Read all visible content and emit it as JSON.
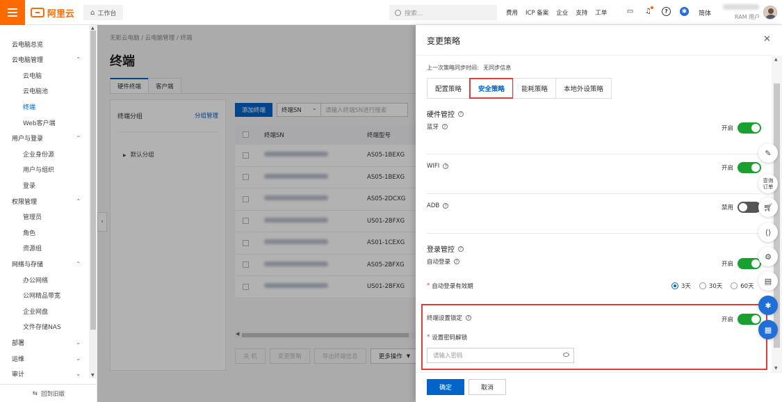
{
  "topbar": {
    "brand": "阿里云",
    "workbench": "工作台",
    "search_placeholder": "搜索...",
    "links": [
      "费用",
      "ICP 备案",
      "企业",
      "支持",
      "工单"
    ],
    "lang": "简体",
    "role": "RAM 用户",
    "icons": [
      "terminal-icon",
      "bell-icon",
      "help-icon",
      "app-icon"
    ]
  },
  "sidebar": {
    "items": [
      {
        "label": "云电脑总览",
        "type": "grp"
      },
      {
        "label": "云电脑管理",
        "type": "grp",
        "chev": "⌃"
      },
      {
        "label": "云电脑",
        "type": "sub"
      },
      {
        "label": "云电脑池",
        "type": "sub"
      },
      {
        "label": "终端",
        "type": "sub",
        "active": true
      },
      {
        "label": "Web客户端",
        "type": "sub"
      },
      {
        "label": "用户与登录",
        "type": "grp",
        "chev": "⌃"
      },
      {
        "label": "企业身份源",
        "type": "sub"
      },
      {
        "label": "用户与组织",
        "type": "sub"
      },
      {
        "label": "登录",
        "type": "sub"
      },
      {
        "label": "权限管理",
        "type": "grp",
        "chev": "⌃"
      },
      {
        "label": "管理员",
        "type": "sub"
      },
      {
        "label": "角色",
        "type": "sub"
      },
      {
        "label": "资源组",
        "type": "sub"
      },
      {
        "label": "网络与存储",
        "type": "grp",
        "chev": "⌃"
      },
      {
        "label": "办公网络",
        "type": "sub"
      },
      {
        "label": "公网精品带宽",
        "type": "sub"
      },
      {
        "label": "企业网盘",
        "type": "sub"
      },
      {
        "label": "文件存储NAS",
        "type": "sub"
      },
      {
        "label": "部署",
        "type": "grp",
        "chev": "⌄"
      },
      {
        "label": "运维",
        "type": "grp",
        "chev": "⌄"
      },
      {
        "label": "审计",
        "type": "grp",
        "chev": "⌄"
      }
    ],
    "footer": "回到旧版"
  },
  "main": {
    "breadcrumb": "无影云电脑 / 云电脑管理 / 终端",
    "title": "终端",
    "tabs": [
      "硬件终端",
      "客户端"
    ],
    "group_panel": {
      "title": "终端分组",
      "manage_link": "分组管理",
      "tree_item": "默认分组"
    },
    "add_button": "添加终端",
    "filter_select": "终端SN",
    "filter_placeholder": "请输入终端SN进行搜索",
    "columns": [
      "终端SN",
      "终端型号"
    ],
    "rows": [
      "AS05-1BEXG",
      "AS05-1BEXG",
      "AS05-2DCXG",
      "US01-2BFXG",
      "AS01-1CEXG",
      "AS05-2BFXG",
      "US01-2BFXG"
    ],
    "bottom_buttons": [
      "关 机",
      "变更策略",
      "导出终端信息",
      "更多操作"
    ]
  },
  "drawer": {
    "title": "变更策略",
    "sync_label": "上一次策略同步时间:",
    "sync_value": "无同步信息",
    "tabs": [
      "配置策略",
      "安全策略",
      "能耗策略",
      "本地外设策略"
    ],
    "hardware_section": "硬件管控",
    "bluetooth": "蓝牙",
    "wifi": "WIFI",
    "adb": "ADB",
    "on_text": "开启",
    "off_text": "禁用",
    "login_section": "登录管控",
    "auto_login": "自动登录",
    "auto_login_validity": "自动登录有效期",
    "validity_options": [
      "3天",
      "30天",
      "60天"
    ],
    "device_lock": "终端设置锁定",
    "set_password_unlock": "设置密码解锁",
    "password_placeholder": "请输入密码",
    "ok": "确定",
    "cancel": "取消"
  },
  "floating": {
    "order_query": [
      "查询",
      "订单"
    ]
  },
  "colors": {
    "brand": "#ff6a00",
    "primary": "#0064c8",
    "switch_on": "#1aa02f",
    "highlight": "#e03c3c"
  }
}
